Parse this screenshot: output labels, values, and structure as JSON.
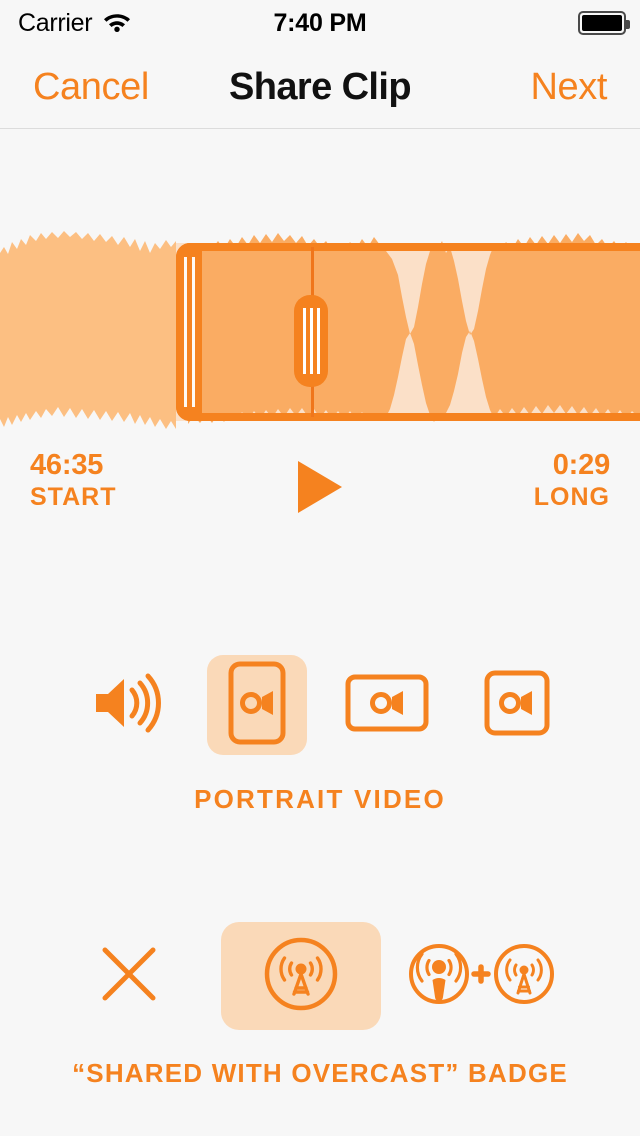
{
  "status_bar": {
    "carrier": "Carrier",
    "wifi_icon": "wifi-icon",
    "time": "7:40 PM",
    "battery_icon": "battery-full-icon"
  },
  "nav_bar": {
    "cancel_label": "Cancel",
    "title": "Share Clip",
    "next_label": "Next"
  },
  "clip": {
    "start_value": "46:35",
    "start_label": "START",
    "length_value": "0:29",
    "length_label": "LONG",
    "play_button_label": "play-icon"
  },
  "format_section": {
    "caption": "PORTRAIT VIDEO",
    "options": [
      {
        "id": "audio",
        "icon": "speaker-waves-icon",
        "selected": false
      },
      {
        "id": "portrait",
        "icon": "video-portrait-icon",
        "selected": true
      },
      {
        "id": "landscape",
        "icon": "video-landscape-icon",
        "selected": false
      },
      {
        "id": "square",
        "icon": "video-square-icon",
        "selected": false
      }
    ]
  },
  "badge_section": {
    "caption": "“SHARED WITH OVERCAST” BADGE",
    "options": [
      {
        "id": "none",
        "icon": "x-close-icon",
        "selected": false
      },
      {
        "id": "overcast",
        "icon": "overcast-tower-icon",
        "selected": true
      },
      {
        "id": "both",
        "icon": "podcast-plus-tower-icon",
        "selected": false
      }
    ]
  },
  "colors": {
    "accent": "#F5821F",
    "accent_dark": "#F0761B",
    "selection_fill": "#FAAC63",
    "selection_bg": "#FBE0C8",
    "unselected_wave": "#FCBF82",
    "highlight_bg": "#FAD9B8",
    "page_bg": "#F7F7F7"
  }
}
